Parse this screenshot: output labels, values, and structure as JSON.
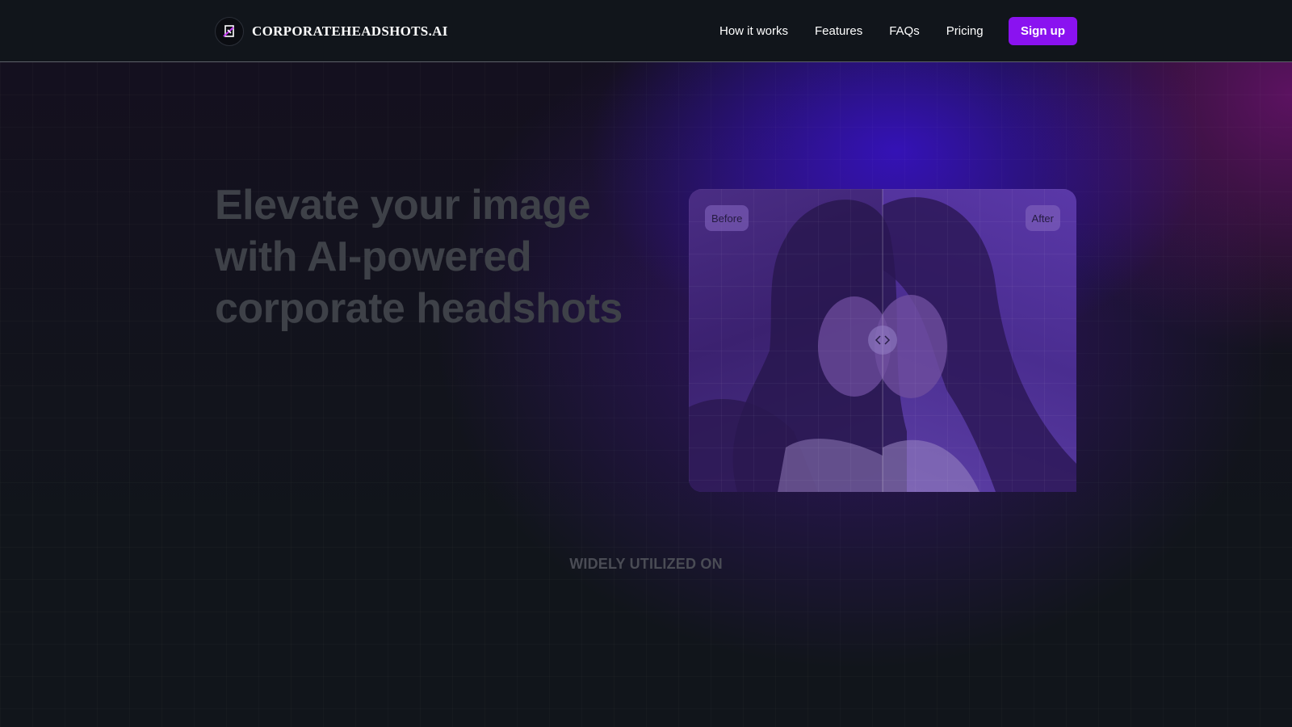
{
  "brand": {
    "name": "CORPORATEHEADSHOTS.AI",
    "logo_icon": "logo-mark-icon"
  },
  "nav": {
    "links": [
      "How it works",
      "Features",
      "FAQs",
      "Pricing"
    ],
    "signup_label": "Sign up"
  },
  "hero": {
    "title": "Elevate your image with AI-powered corporate headshots"
  },
  "comparison": {
    "before_label": "Before",
    "after_label": "After",
    "handle_icon": "chevrons-left-right-icon"
  },
  "section": {
    "label": "WIDELY UTILIZED ON"
  },
  "colors": {
    "background": "#11151b",
    "accent": "#8a12f0",
    "glow": "#3a12dc"
  }
}
